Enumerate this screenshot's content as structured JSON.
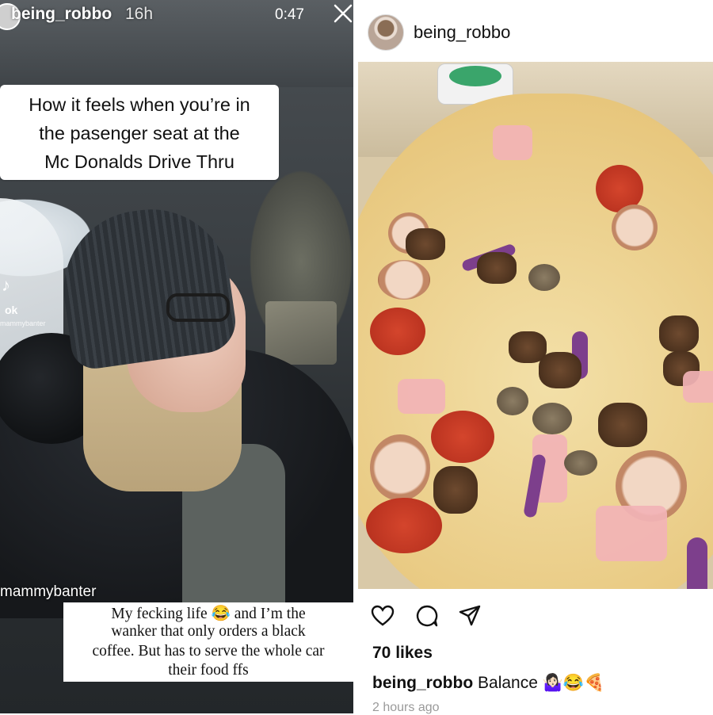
{
  "story": {
    "username": "being_robbo",
    "age": "16h",
    "timer": "0:47",
    "caption_lines": [
      "How it feels when you’re in",
      "the pasenger seat at the",
      "Mc Donalds Drive Thru"
    ],
    "tiktok_word": "ok",
    "tiktok_handle_small": "mammybanter",
    "tiktok_handle": "mammybanter",
    "comment_lines": [
      "My fecking life 😂 and I’m the",
      "wanker that only orders a black",
      "coffee. But has to serve the whole car",
      "their food ffs"
    ]
  },
  "post": {
    "username": "being_robbo",
    "likes": "70 likes",
    "caption_user": "being_robbo",
    "caption_text": "Balance 🤷🏻‍♀️😂🍕",
    "time": "2 hours ago",
    "icons": [
      "heart-icon",
      "comment-icon",
      "share-icon"
    ]
  },
  "colors": {
    "accent": "#111111",
    "muted": "#9a9a9a"
  }
}
